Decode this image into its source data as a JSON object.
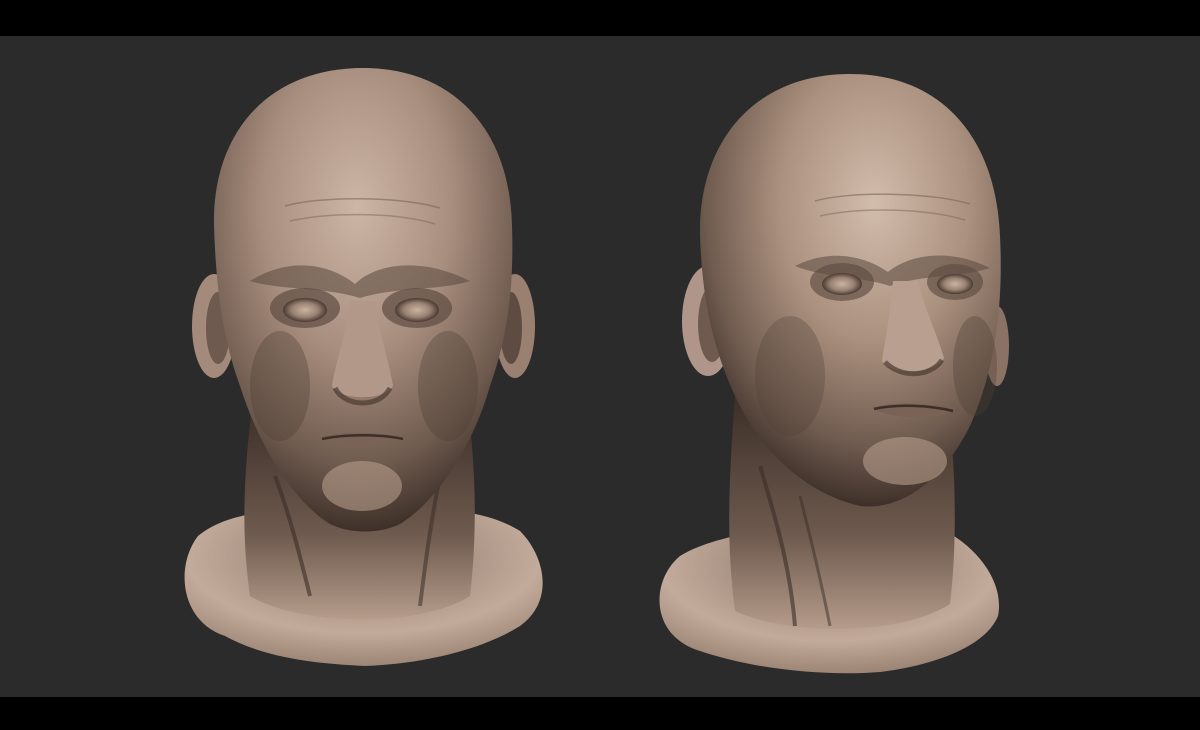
{
  "scene": {
    "background_color": "#2b2b2b",
    "letterbox_color": "#000000",
    "skin_base": "#a08878",
    "skin_light": "#c9b2a2",
    "skin_shadow": "#4a3a32",
    "models": [
      {
        "name": "head-sculpt-front-view",
        "view": "front"
      },
      {
        "name": "head-sculpt-three-quarter-view",
        "view": "three-quarter"
      }
    ]
  }
}
